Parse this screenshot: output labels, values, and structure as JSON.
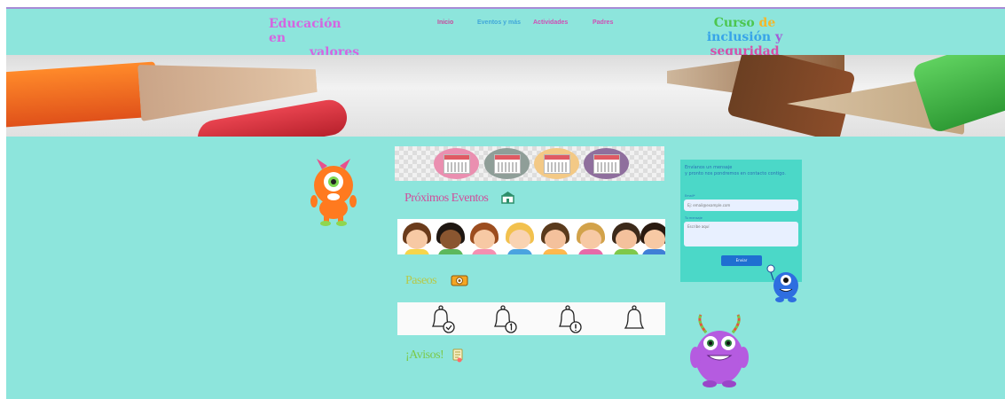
{
  "header": {
    "brand_line1": "Educación en",
    "brand_line2": "valores",
    "nav": [
      "Inicio",
      "Eventos y más",
      "Actividades",
      "Padres"
    ],
    "course_w1": "Curso",
    "course_w2": "de",
    "course_w3": "inclusión",
    "course_w4": "y",
    "course_line2": "seguridad"
  },
  "sections": {
    "events_title": "Próximos Eventos",
    "walks_title": "Paseos",
    "notices_title": "¡Avisos!"
  },
  "contact": {
    "message_line1": "Envíanos un mensaje",
    "message_line2": "y pronto nos pondremos en contacto contigo.",
    "email_label": "Email*",
    "email_placeholder": "Ej: email@example.com",
    "message_label": "Tu mensaje",
    "message_placeholder": "Escribe aquí",
    "send_label": "Enviar"
  },
  "colors": {
    "page_bg": "#8de5dc",
    "form_bg": "#4bd8c8",
    "send_button": "#1f6fd1"
  }
}
